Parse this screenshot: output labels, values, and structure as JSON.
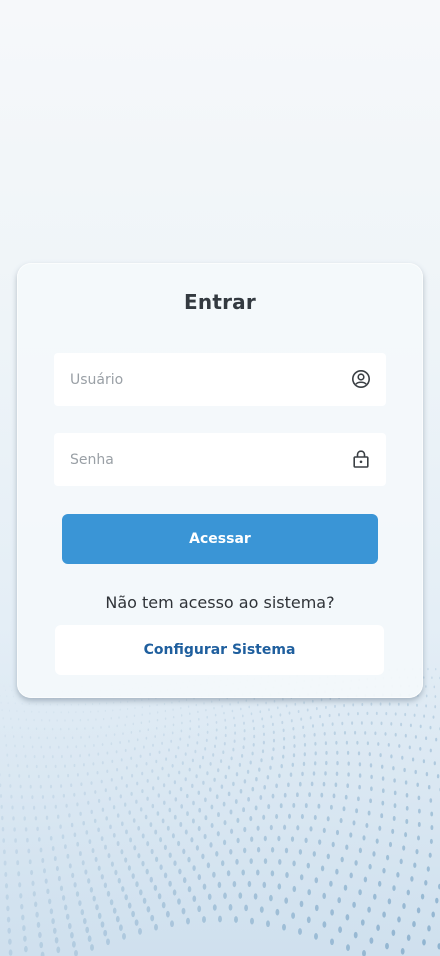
{
  "login": {
    "title": "Entrar",
    "username_placeholder": "Usuário",
    "username_value": "",
    "username_icon": "user-circle-icon",
    "password_placeholder": "Senha",
    "password_value": "",
    "password_icon": "lock-icon",
    "submit_label": "Acessar",
    "no_access_text": "Não tem acesso ao sistema?",
    "configure_label": "Configurar Sistema"
  },
  "colors": {
    "primary": "#3a95d6",
    "secondary_text": "#1f5f9e",
    "title_text": "#333a40",
    "background_top": "#f6f8fa",
    "background_bottom": "#cfe0ee",
    "pattern_dots": "#8fb3cf"
  }
}
